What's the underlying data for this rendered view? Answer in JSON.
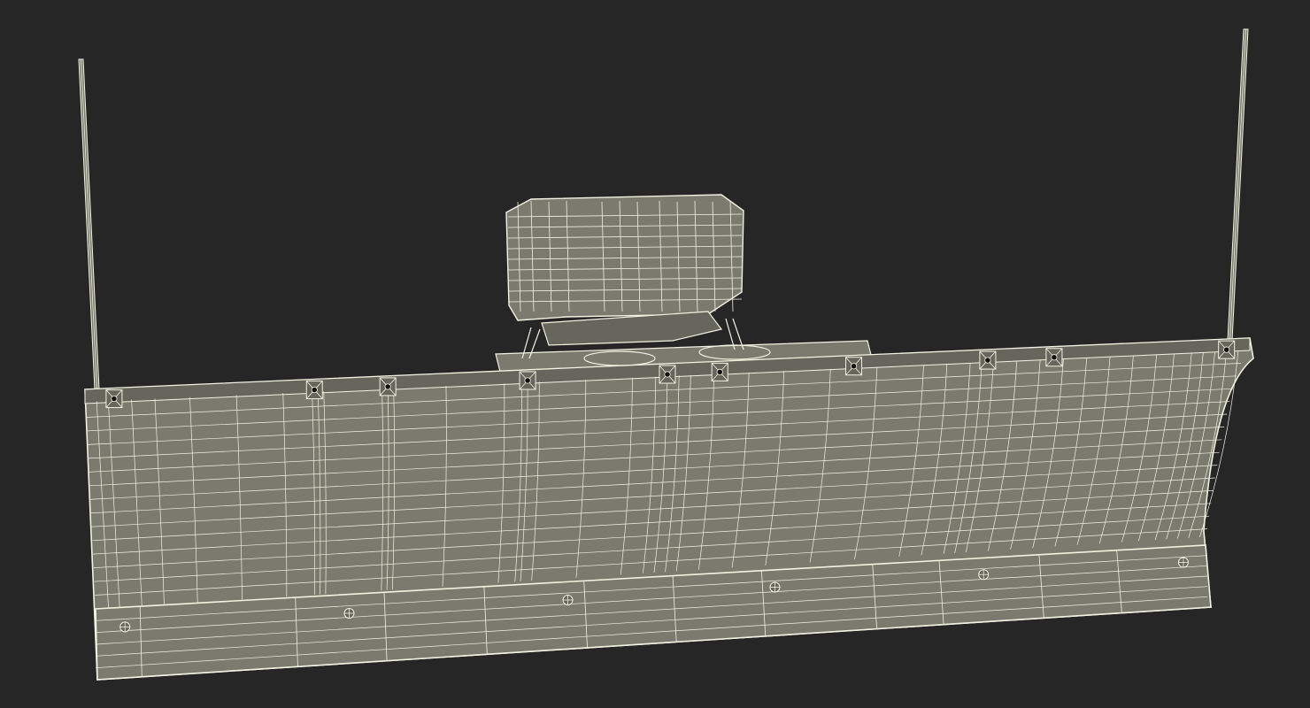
{
  "scene": {
    "subject": "snow-plow-blade-wireframe",
    "colors": {
      "background": "#262626",
      "surface": "#7a7a6e",
      "surface_dark": "#66665c",
      "wire": "#f2f2e2",
      "hole": "#111111"
    }
  }
}
